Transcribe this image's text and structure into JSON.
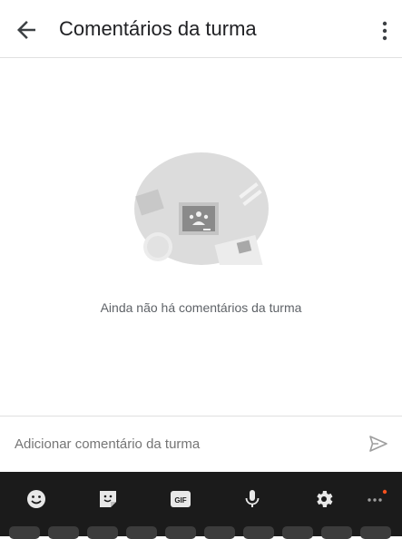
{
  "header": {
    "title": "Comentários da turma",
    "back_icon": "arrow-back-icon",
    "more_icon": "more-vert-icon"
  },
  "empty_state": {
    "message": "Ainda não há comentários da turma",
    "illustration": "classroom-empty-illustration"
  },
  "composer": {
    "placeholder": "Adicionar comentário da turma",
    "value": "",
    "send_icon": "send-icon"
  },
  "keyboard": {
    "toolbar": [
      {
        "name": "emoji-icon"
      },
      {
        "name": "sticker-icon"
      },
      {
        "name": "gif-icon",
        "label": "GIF"
      },
      {
        "name": "microphone-icon"
      },
      {
        "name": "settings-icon"
      },
      {
        "name": "more-horiz-icon"
      }
    ],
    "accent_dot_color": "#f4511e"
  },
  "colors": {
    "text_primary": "#202124",
    "text_secondary": "#5f6368",
    "divider": "#e0e0e0",
    "keyboard_bg": "#1b1b1b"
  }
}
